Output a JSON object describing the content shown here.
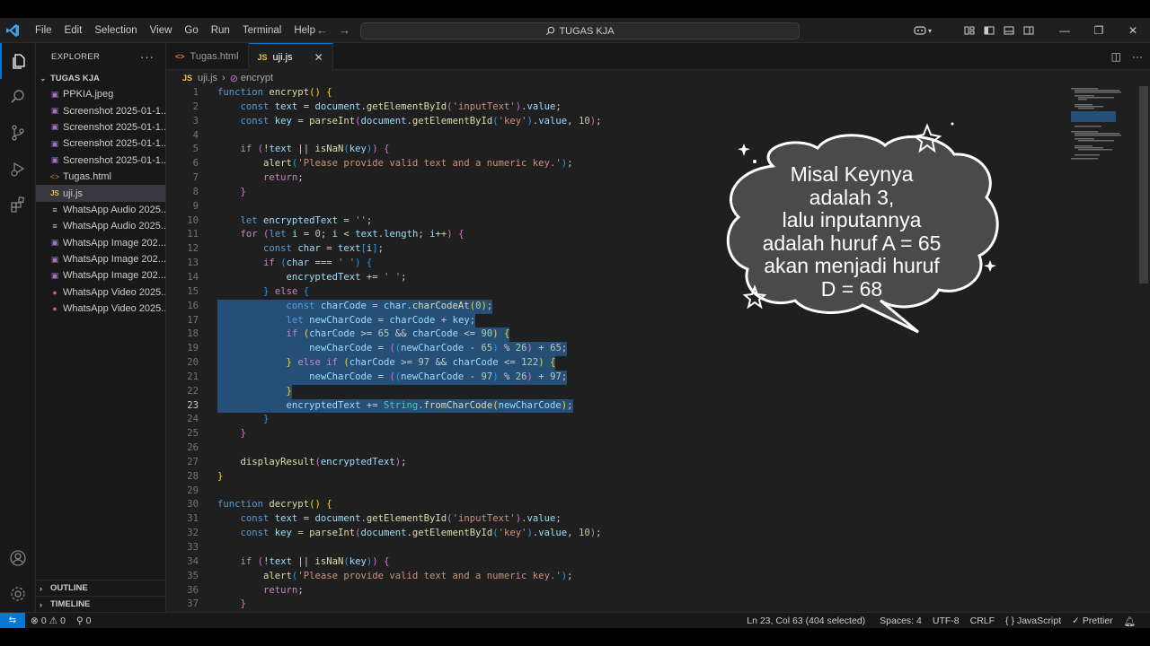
{
  "window": {
    "menu": [
      "File",
      "Edit",
      "Selection",
      "View",
      "Go",
      "Run",
      "Terminal",
      "Help"
    ],
    "search_text": "TUGAS KJA"
  },
  "sidebar": {
    "header": "EXPLORER",
    "folder": "TUGAS KJA",
    "files": [
      {
        "name": "PPKIA.jpeg",
        "icon": "image-file-icon",
        "color": "#a074c4"
      },
      {
        "name": "Screenshot 2025-01-1...",
        "icon": "image-file-icon",
        "color": "#a074c4"
      },
      {
        "name": "Screenshot 2025-01-1...",
        "icon": "image-file-icon",
        "color": "#a074c4"
      },
      {
        "name": "Screenshot 2025-01-1...",
        "icon": "image-file-icon",
        "color": "#a074c4"
      },
      {
        "name": "Screenshot 2025-01-1...",
        "icon": "image-file-icon",
        "color": "#a074c4"
      },
      {
        "name": "Tugas.html",
        "icon": "html-file-icon",
        "color": "#e37933"
      },
      {
        "name": "uji.js",
        "icon": "js-file-icon",
        "color": "#e8c547",
        "active": true
      },
      {
        "name": "WhatsApp Audio 2025...",
        "icon": "audio-file-icon",
        "color": "#cccccc"
      },
      {
        "name": "WhatsApp Audio 2025...",
        "icon": "audio-file-icon",
        "color": "#cccccc"
      },
      {
        "name": "WhatsApp Image 202...",
        "icon": "image-file-icon",
        "color": "#a074c4"
      },
      {
        "name": "WhatsApp Image 202...",
        "icon": "image-file-icon",
        "color": "#a074c4"
      },
      {
        "name": "WhatsApp Image 202...",
        "icon": "image-file-icon",
        "color": "#a074c4"
      },
      {
        "name": "WhatsApp Video 2025...",
        "icon": "video-file-icon",
        "color": "#e05561"
      },
      {
        "name": "WhatsApp Video 2025...",
        "icon": "video-file-icon",
        "color": "#e05561"
      }
    ],
    "outline": "OUTLINE",
    "timeline": "TIMELINE"
  },
  "tabs": [
    {
      "label": "Tugas.html",
      "icon": "html-file-icon",
      "active": false
    },
    {
      "label": "uji.js",
      "icon": "js-file-icon",
      "active": true
    }
  ],
  "breadcrumb": {
    "file": "uji.js",
    "symbol": "encrypt"
  },
  "code_lines": [
    {
      "n": "1",
      "html": "<span class='kw'>function</span> <span class='fn'>encrypt</span><span class='br1'>()</span> <span class='br1'>{</span>"
    },
    {
      "n": "2",
      "html": "    <span class='kw'>const</span> <span class='var'>text</span> = <span class='var'>document</span>.<span class='fn'>getElementById</span><span class='br2'>(</span><span class='str'>'inputText'</span><span class='br2'>)</span>.<span class='var'>value</span>;"
    },
    {
      "n": "3",
      "html": "    <span class='kw'>const</span> <span class='var'>key</span> = <span class='fn'>parseInt</span><span class='br2'>(</span><span class='var'>document</span>.<span class='fn'>getElementById</span><span class='br3'>(</span><span class='str'>'key'</span><span class='br3'>)</span>.<span class='var'>value</span>, <span class='num'>10</span><span class='br2'>)</span>;"
    },
    {
      "n": "4",
      "html": ""
    },
    {
      "n": "5",
      "html": "    <span class='ctl'>if</span> <span class='br2'>(</span>!<span class='var'>text</span> || <span class='fn'>isNaN</span><span class='br3'>(</span><span class='var'>key</span><span class='br3'>)</span><span class='br2'>)</span> <span class='br2'>{</span>"
    },
    {
      "n": "6",
      "html": "        <span class='fn'>alert</span><span class='br3'>(</span><span class='str'>'Please provide valid text and a numeric key.'</span><span class='br3'>)</span>;"
    },
    {
      "n": "7",
      "html": "        <span class='ctl'>return</span>;"
    },
    {
      "n": "8",
      "html": "    <span class='br2'>}</span>"
    },
    {
      "n": "9",
      "html": ""
    },
    {
      "n": "10",
      "html": "    <span class='kw'>let</span> <span class='var'>encryptedText</span> = <span class='str'>''</span>;"
    },
    {
      "n": "11",
      "html": "    <span class='ctl'>for</span> <span class='br2'>(</span><span class='kw'>let</span> <span class='var'>i</span> = <span class='num'>0</span>; <span class='var'>i</span> &lt; <span class='var'>text</span>.<span class='var'>length</span>; <span class='var'>i</span>++<span class='br2'>)</span> <span class='br2'>{</span>"
    },
    {
      "n": "12",
      "html": "        <span class='kw'>const</span> <span class='var'>char</span> = <span class='var'>text</span><span class='br3'>[</span><span class='var'>i</span><span class='br3'>]</span>;"
    },
    {
      "n": "13",
      "html": "        <span class='ctl'>if</span> <span class='br3'>(</span><span class='var'>char</span> === <span class='str'>' '</span><span class='br3'>)</span> <span class='br3'>{</span>"
    },
    {
      "n": "14",
      "html": "            <span class='var'>encryptedText</span> += <span class='str'>' '</span>;"
    },
    {
      "n": "15",
      "html": "        <span class='br3'>}</span> <span class='ctl'>else</span> <span class='br3'>{</span>"
    },
    {
      "n": "16",
      "sel": true,
      "bulb": true,
      "html": "            <span class='kw'>const</span> <span class='var'>charCode</span> = <span class='var'>char</span>.<span class='fn'>charCodeAt</span><span class='br1'>(</span><span class='num'>0</span><span class='br1'>)</span>;"
    },
    {
      "n": "17",
      "sel": true,
      "html": "            <span class='kw'>let</span> <span class='var'>newCharCode</span> = <span class='var'>charCode</span> + <span class='var'>key</span>;"
    },
    {
      "n": "18",
      "sel": true,
      "html": "            <span class='ctl'>if</span> <span class='br1'>(</span><span class='var'>charCode</span> &gt;= <span class='num'>65</span> &amp;&amp; <span class='var'>charCode</span> &lt;= <span class='num'>90</span><span class='br1'>)</span> <span class='br1'>{</span>"
    },
    {
      "n": "19",
      "sel": true,
      "html": "                <span class='var'>newCharCode</span> = <span class='br2'>(</span><span class='br3'>(</span><span class='var'>newCharCode</span> - <span class='num'>65</span><span class='br3'>)</span> % <span class='num'>26</span><span class='br2'>)</span> + <span class='num'>65</span>;"
    },
    {
      "n": "20",
      "sel": true,
      "html": "            <span class='br1'>}</span> <span class='ctl'>else</span> <span class='ctl'>if</span> <span class='br1'>(</span><span class='var'>charCode</span> &gt;= <span class='num'>97</span> &amp;&amp; <span class='var'>charCode</span> &lt;= <span class='num'>122</span><span class='br1'>)</span> <span class='br1'>{</span>"
    },
    {
      "n": "21",
      "sel": true,
      "html": "                <span class='var'>newCharCode</span> = <span class='br2'>(</span><span class='br3'>(</span><span class='var'>newCharCode</span> - <span class='num'>97</span><span class='br3'>)</span> % <span class='num'>26</span><span class='br2'>)</span> + <span class='num'>97</span>;"
    },
    {
      "n": "22",
      "sel": true,
      "html": "            <span class='br1'>}</span>"
    },
    {
      "n": "23",
      "sel": true,
      "cur": true,
      "html": "            <span class='var'>encryptedText</span> += <span class='cls'>String</span>.<span class='fn'>fromCharCode</span><span class='br1'>(</span><span class='var'>newCharCode</span><span class='br1'>)</span>;"
    },
    {
      "n": "24",
      "html": "        <span class='br3'>}</span>"
    },
    {
      "n": "25",
      "html": "    <span class='br2'>}</span>"
    },
    {
      "n": "26",
      "html": ""
    },
    {
      "n": "27",
      "html": "    <span class='fn'>displayResult</span><span class='br2'>(</span><span class='var'>encryptedText</span><span class='br2'>)</span>;"
    },
    {
      "n": "28",
      "html": "<span class='br1'>}</span>"
    },
    {
      "n": "29",
      "html": ""
    },
    {
      "n": "30",
      "html": "<span class='kw'>function</span> <span class='fn'>decrypt</span><span class='br1'>()</span> <span class='br1'>{</span>"
    },
    {
      "n": "31",
      "html": "    <span class='kw'>const</span> <span class='var'>text</span> = <span class='var'>document</span>.<span class='fn'>getElementById</span><span class='br2'>(</span><span class='str'>'inputText'</span><span class='br2'>)</span>.<span class='var'>value</span>;"
    },
    {
      "n": "32",
      "html": "    <span class='kw'>const</span> <span class='var'>key</span> = <span class='fn'>parseInt</span><span class='br2'>(</span><span class='var'>document</span>.<span class='fn'>getElementById</span><span class='br3'>(</span><span class='str'>'key'</span><span class='br3'>)</span>.<span class='var'>value</span>, <span class='num'>10</span><span class='br2'>)</span>;"
    },
    {
      "n": "33",
      "html": ""
    },
    {
      "n": "34",
      "html": "    <span class='ctl'>if</span> <span class='br2'>(</span>!<span class='var'>text</span> || <span class='fn'>isNaN</span><span class='br3'>(</span><span class='var'>key</span><span class='br3'>)</span><span class='br2'>)</span> <span class='br2'>{</span>"
    },
    {
      "n": "35",
      "html": "        <span class='fn'>alert</span><span class='br3'>(</span><span class='str'>'Please provide valid text and a numeric key.'</span><span class='br3'>)</span>;"
    },
    {
      "n": "36",
      "html": "        <span class='ctl'>return</span>;"
    },
    {
      "n": "37",
      "html": "    <span class='br2'>}</span>"
    }
  ],
  "annotation": {
    "lines": [
      "Misal Keynya",
      "adalah 3,",
      "lalu inputannya",
      "adalah huruf A = 65",
      "akan menjadi huruf",
      "D = 68"
    ]
  },
  "statusbar": {
    "errors": "0",
    "warnings": "0",
    "ports": "0",
    "position": "Ln 23, Col 63 (404 selected)",
    "spaces": "Spaces: 4",
    "encoding": "UTF-8",
    "eol": "CRLF",
    "language": "JavaScript",
    "formatter": "Prettier"
  },
  "colors": {
    "accent": "#0078d4",
    "selection": "#264f78",
    "editor_bg": "#1f1f1f",
    "sidebar_bg": "#181818"
  }
}
